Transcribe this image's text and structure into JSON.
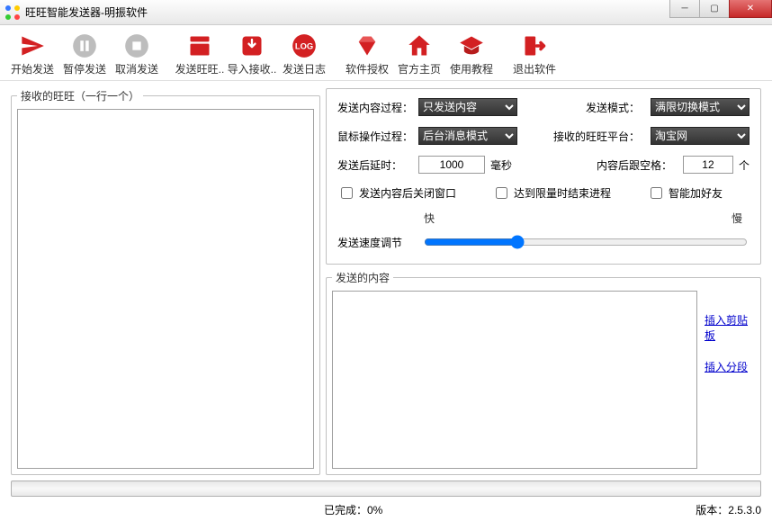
{
  "window": {
    "title": "旺旺智能发送器-明振软件"
  },
  "toolbar": [
    {
      "label": "开始发送",
      "icon": "paper-plane"
    },
    {
      "label": "暂停发送",
      "icon": "pause-circle"
    },
    {
      "label": "取消发送",
      "icon": "stop-circle"
    },
    {
      "label": "发送旺旺..",
      "icon": "export-box"
    },
    {
      "label": "导入接收..",
      "icon": "import-down"
    },
    {
      "label": "发送日志",
      "icon": "log"
    },
    {
      "label": "软件授权",
      "icon": "diamond"
    },
    {
      "label": "官方主页",
      "icon": "home"
    },
    {
      "label": "使用教程",
      "icon": "grad-cap"
    },
    {
      "label": "退出软件",
      "icon": "exit"
    }
  ],
  "leftPanel": {
    "legend": "接收的旺旺（一行一个）",
    "value": ""
  },
  "options": {
    "sendContentProcessLabel": "发送内容过程：",
    "sendContentProcessValue": "只发送内容",
    "sendModeLabel": "发送模式：",
    "sendModeValue": "满限切换模式",
    "mouseOpLabel": "鼠标操作过程：",
    "mouseOpValue": "后台消息模式",
    "recvPlatformLabel": "接收的旺旺平台：",
    "recvPlatformValue": "淘宝网",
    "delayLabel": "发送后延时：",
    "delayValue": "1000",
    "delayUnit": "毫秒",
    "spacesLabel": "内容后跟空格：",
    "spacesValue": "12",
    "spacesUnit": "个",
    "chkCloseAfter": "发送内容后关闭窗口",
    "chkEndOnLimit": "达到限量时结束进程",
    "chkSmartFriend": "智能加好友",
    "speedFast": "快",
    "speedSlow": "慢",
    "speedLabel": "发送速度调节"
  },
  "contentPanel": {
    "legend": "发送的内容",
    "value": "",
    "linkClipboard": "插入剪贴板",
    "linkSegment": "插入分段"
  },
  "status": {
    "completedLabel": "已完成：",
    "completedValue": "0%",
    "versionLabel": "版本：",
    "versionValue": "2.5.3.0"
  }
}
